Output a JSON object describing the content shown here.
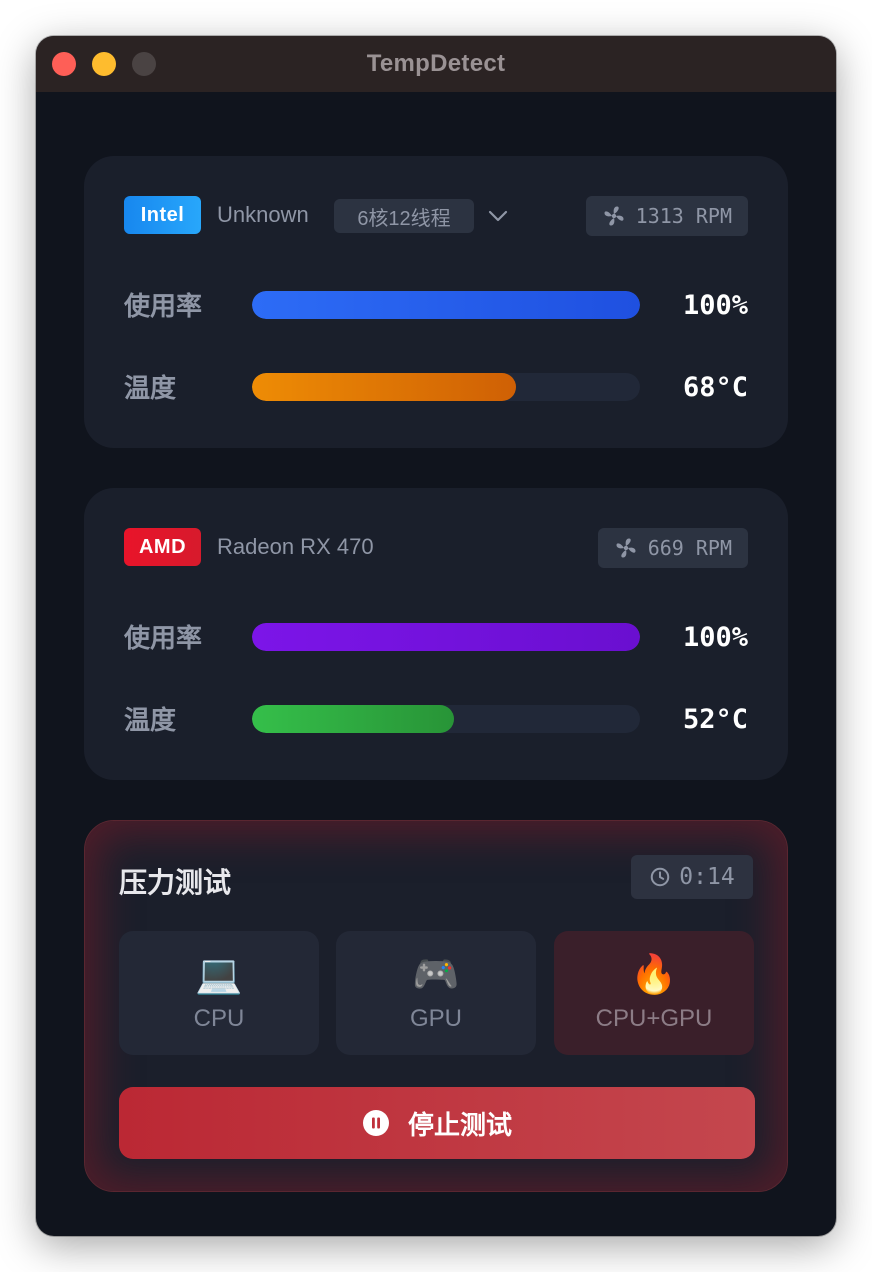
{
  "window": {
    "title": "TempDetect"
  },
  "cpu": {
    "brand": "Intel",
    "model": "Unknown",
    "cores": "6核12线程",
    "fan_rpm": "1313 RPM",
    "usage_label": "使用率",
    "usage_value": "100%",
    "usage_fraction": 1.0,
    "temp_label": "温度",
    "temp_value": "68°C",
    "temp_fraction": 0.68,
    "colors": {
      "brand": "#1e97f5",
      "usage": "#2563eb",
      "temp": "#e07b00"
    }
  },
  "gpu": {
    "brand": "AMD",
    "model": "Radeon RX 470",
    "fan_rpm": "669 RPM",
    "usage_label": "使用率",
    "usage_value": "100%",
    "usage_fraction": 1.0,
    "temp_label": "温度",
    "temp_value": "52°C",
    "temp_fraction": 0.52,
    "colors": {
      "brand": "#e3162b",
      "usage": "#7410e0",
      "temp": "#2fb54a"
    }
  },
  "stress_test": {
    "title": "压力测试",
    "timer": "0:14",
    "modes": [
      {
        "icon": "laptop-icon",
        "glyph": "💻",
        "label": "CPU"
      },
      {
        "icon": "gamepad-icon",
        "glyph": "🎮",
        "label": "GPU"
      },
      {
        "icon": "fire-icon",
        "glyph": "🔥",
        "label": "CPU+GPU",
        "selected": true
      }
    ],
    "stop_label": "停止测试"
  }
}
